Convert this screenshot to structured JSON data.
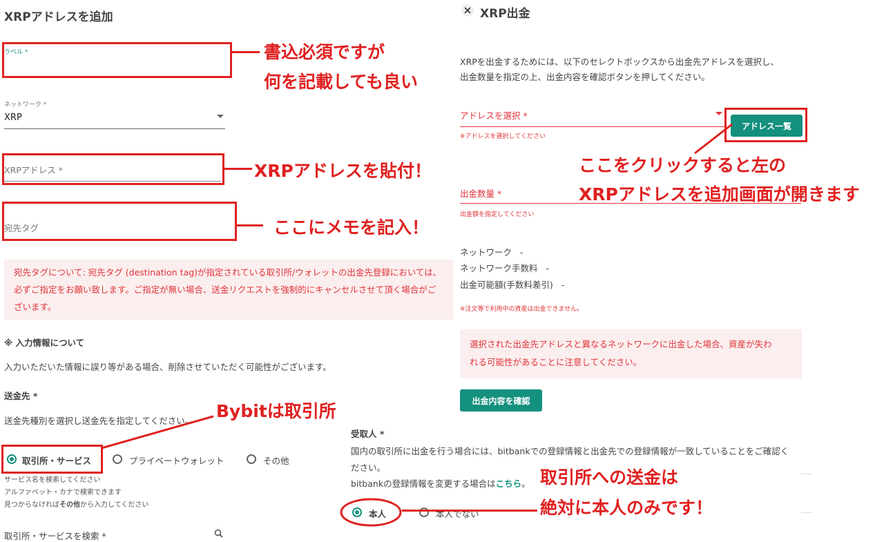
{
  "left": {
    "title": "XRPアドレスを追加",
    "label_field": {
      "label": "ラベル *"
    },
    "network_field": {
      "label": "ネットワーク *",
      "value": "XRP"
    },
    "address_field": {
      "placeholder": "XRPアドレス *"
    },
    "tag_field": {
      "placeholder": "宛先タグ"
    },
    "notice": "宛先タグについて: 宛先タグ (destination tag)が指定されている取引所/ウォレットの出金先登録においては、必ずご指定をお願い致します。ご指定が無い場合、送金リクエストを強制的にキャンセルさせて頂く場合がございます。",
    "info_heading": "※ 入力情報について",
    "info_text": "入力いただいた情報に誤り等がある場合、削除させていただく可能性がございます。",
    "dest_heading": "送金先 *",
    "dest_text": "送金先種別を選択し送金先を指定してください。",
    "dest_options": [
      "取引所・サービス",
      "プライベートウォレット",
      "その他"
    ],
    "hint1": "サービス名を検索してください",
    "hint2": "アルファベット・カナで検索できます",
    "hint3_pre": "見つからなければ",
    "hint3_bold": "その他",
    "hint3_post": "から入力してください",
    "search_label": "取引所・サービスを検索 *"
  },
  "right": {
    "title": "XRP出金",
    "intro_line1": "XRPを出金するためには、以下のセレクトボックスから出金先アドレスを選択し、",
    "intro_line2": "出金数量を指定の上、出金内容を確認ボタンを押してください。",
    "address_select": "アドレスを選択 *",
    "address_error": "※アドレスを選択してください",
    "address_list_button": "アドレス一覧",
    "amount_label": "出金数量 *",
    "amount_error": "出金額を指定してください",
    "network_label": "ネットワーク",
    "network_value": "-",
    "fee_label": "ネットワーク手数料",
    "fee_value": "-",
    "available_label": "出金可能額(手数料差引)",
    "available_value": "-",
    "order_note": "※注文等で利用中の資産は出金できません。",
    "warning_line1": "選択された出金先アドレスと異なるネットワークに出金した場合、資産が失わ",
    "warning_line2": "れる可能性があることに注意してください。",
    "confirm_button": "出金内容を確認"
  },
  "recipient": {
    "heading": "受取人 *",
    "line1": "国内の取引所に出金を行う場合には、bitbankでの登録情報と出金先での登録情報が一致していることをご確認く",
    "line2": "ださい。",
    "line3_pre": "bitbankの登録情報を変更する場合は",
    "line3_link": "こちら",
    "line3_post": "。",
    "options": [
      "本人",
      "本人でない"
    ]
  },
  "annotations": {
    "a1_line1": "書込必須ですが",
    "a1_line2": "何を記載しても良い",
    "a2": "XRPアドレスを貼付！",
    "a3": "ここにメモを記入！",
    "a4_line1": "ここをクリックすると左の",
    "a4_line2": "XRPアドレスを追加画面が開きます",
    "a5": "Bybitは取引所",
    "a6_line1": "取引所への送金は",
    "a6_line2": "絶対に本人のみです！"
  },
  "colors": {
    "accent": "#14907e",
    "annotation": "#e02020",
    "error": "#e0343a",
    "notice_bg": "#fbeeee"
  },
  "icons": {
    "close": "close-icon",
    "dropdown": "caret-down-icon",
    "search": "search-icon"
  }
}
